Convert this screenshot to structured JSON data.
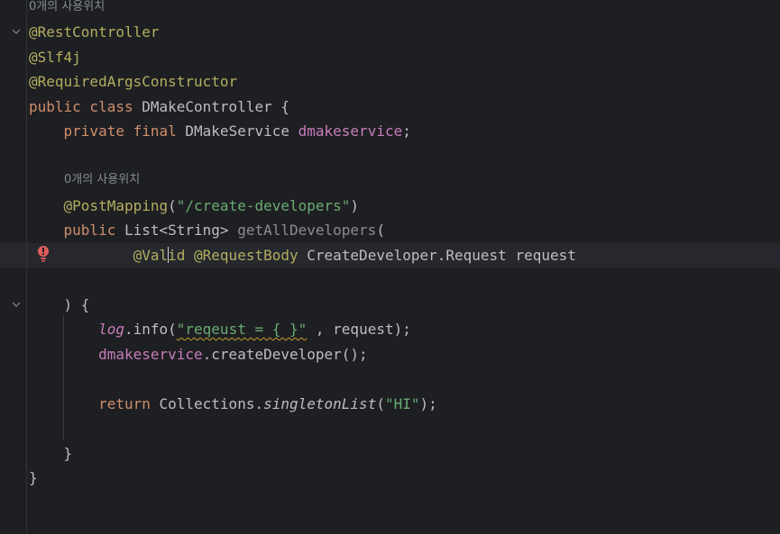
{
  "editor": {
    "usage_hint_top": "0개의 사용위치",
    "usage_hint_method": "0개의 사용위치",
    "lines": {
      "l1_ann": "@RestController",
      "l2_ann": "@Slf4j",
      "l3_ann": "@RequiredArgsConstructor",
      "l4_kw": "public class",
      "l4_name": " DMakeController {",
      "l5_kw": "    private final",
      "l5_type": " DMakeService ",
      "l5_field": "dmakeservice",
      "l5_end": ";",
      "l7_ann": "    @PostMapping",
      "l7_open": "(",
      "l7_str": "\"/create-developers\"",
      "l7_close": ")",
      "l8_kw": "    public",
      "l8_type": " List<String> ",
      "l8_method": "getAllDevelopers",
      "l8_paren": "(",
      "l9_indent": "            ",
      "l9_ann_a": "@Val",
      "l9_ann_b": "id",
      "l9_ann2": " @RequestBody",
      "l9_rest": " CreateDeveloper.Request request",
      "l11_text": "    ) {",
      "l12_indent": "        ",
      "l12_log": "log",
      "l12_info": ".info(",
      "l12_str": "\"reqeust = { }\"",
      "l12_rest": " , request);",
      "l13_indent": "        ",
      "l13_field": "dmakeservice",
      "l13_rest": ".createDeveloper();",
      "l15_indent": "        ",
      "l15_kw": "return",
      "l15_cls": " Collections.",
      "l15_method": "singletonList",
      "l15_open": "(",
      "l15_str": "\"HI\"",
      "l15_close": ");",
      "l17_text": "    }",
      "l18_text": "}"
    }
  }
}
